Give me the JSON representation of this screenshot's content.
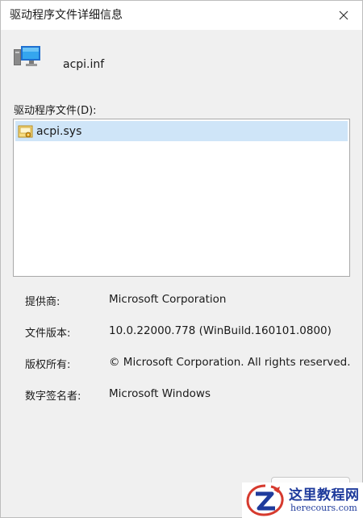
{
  "window": {
    "title": "驱动程序文件详细信息"
  },
  "header": {
    "file_name": "acpi.inf",
    "icon": "computer-monitor-icon"
  },
  "file_list": {
    "label": "驱动程序文件(D):",
    "items": [
      {
        "name": "acpi.sys",
        "icon": "system-file-icon",
        "selected": true
      }
    ]
  },
  "details": [
    {
      "label": "提供商:",
      "value": "Microsoft Corporation"
    },
    {
      "label": "文件版本:",
      "value": "10.0.22000.778 (WinBuild.160101.0800)"
    },
    {
      "label": "版权所有:",
      "value": "© Microsoft Corporation. All rights reserved."
    },
    {
      "label": "数字签名者:",
      "value": "Microsoft Windows"
    }
  ],
  "watermark": {
    "title": "这里教程网",
    "url": "herecours.com"
  },
  "colors": {
    "selection": "#cfe5f8",
    "watermark": "#1f3b9c"
  }
}
